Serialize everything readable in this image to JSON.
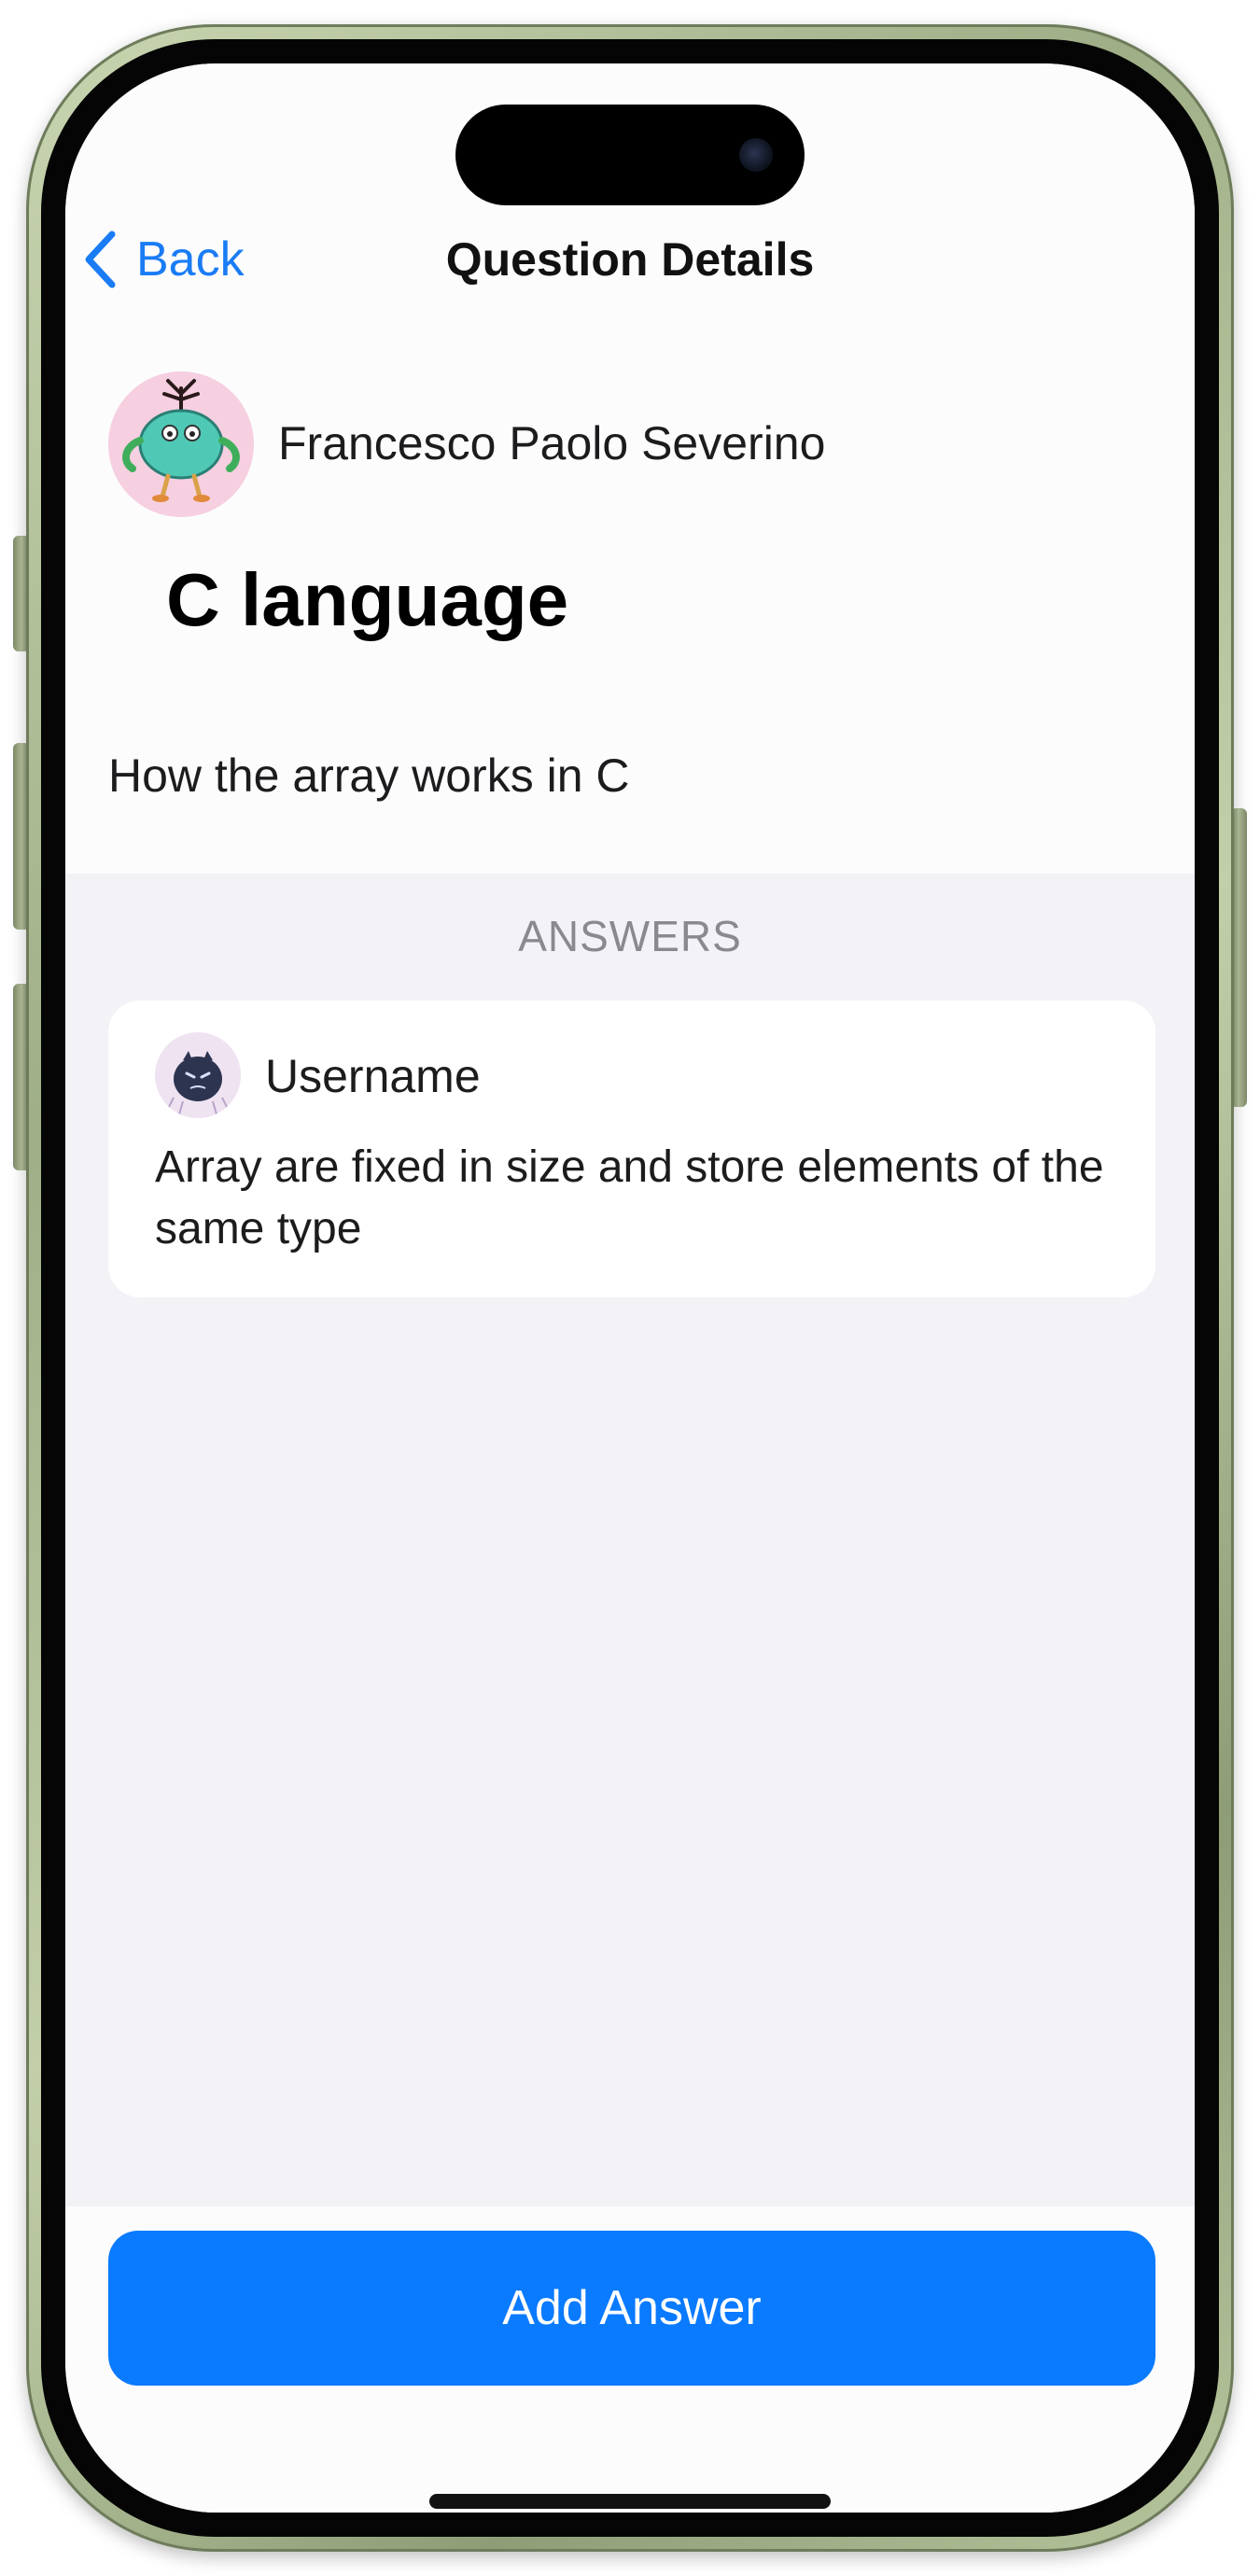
{
  "nav": {
    "back_label": "Back",
    "title": "Question Details"
  },
  "question": {
    "author_name": "Francesco Paolo Severino",
    "title": "C language",
    "body": "How the array works in C"
  },
  "answers": {
    "header": "ANSWERS",
    "items": [
      {
        "username": "Username",
        "text": "Array are fixed in size and store elements of the same type"
      }
    ]
  },
  "actions": {
    "add_answer_label": "Add Answer"
  },
  "colors": {
    "accent": "#0a7aff",
    "background": "#f2f2f7",
    "frame": "#a9b790"
  },
  "icons": {
    "back": "chevron-left-icon",
    "author_avatar": "monster-avatar-icon",
    "answer_avatar": "dark-creature-avatar-icon"
  }
}
